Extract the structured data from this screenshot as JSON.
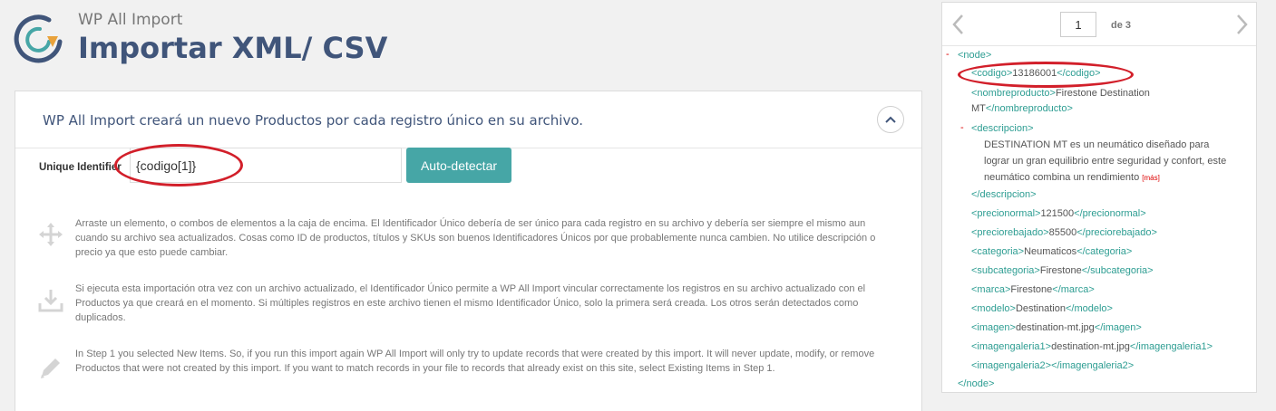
{
  "header": {
    "brand": "WP All Import",
    "title": "Importar XML/ CSV"
  },
  "panel": {
    "title": "WP All Import creará un nuevo Productos por cada registro único en su archivo.",
    "unique_label": "Unique Identifier",
    "unique_value": "{codigo[1]}",
    "auto_detect_label": "Auto-detectar",
    "info": [
      {
        "icon": "move-icon",
        "text": "Arraste un elemento, o combos de elementos a la caja de encima. El Identificador Único debería de ser único para cada registro en su archivo y debería ser siempre el mismo aun cuando su archivo sea actualizados. Cosas como ID de productos, títulos y SKUs son buenos Identificadores Únicos por que probablemente nunca cambien. No utilice descripción o precio ya que esto puede cambiar."
      },
      {
        "icon": "download-icon",
        "text": "Si ejecuta esta importación otra vez con un archivo actualizado, el Identificador Único permite a WP All Import vincular correctamente los registros en su archivo actualizado con el Productos ya que creará en el momento. Si múltiples registros en este archivo tienen el mismo Identificador Único, solo la primera será creada. Los otros serán detectados como duplicados."
      },
      {
        "icon": "pencil-icon",
        "text": "In Step 1 you selected New Items. So, if you run this import again WP All Import will only try to update records that were created by this import. It will never update, modify, or remove Productos that were not created by this import. If you want to match records in your file to records that already exist on this site, select Existing Items in Step 1."
      }
    ]
  },
  "xml": {
    "page": "1",
    "of_label": "de 3",
    "toggle": "-",
    "more_label": "[más]",
    "lines": {
      "node_open": "<node>",
      "codigo_open": "<codigo>",
      "codigo_val": "13186001",
      "codigo_close": "</codigo>",
      "nombre_open": "<nombreproducto>",
      "nombre_val1": "Firestone Destination",
      "nombre_val2": "MT",
      "nombre_close": "</nombreproducto>",
      "desc_open": "<descripcion>",
      "desc_val1": "DESTINATION MT es un neumático diseñado para",
      "desc_val2": "lograr un gran equilibrio entre seguridad y confort, este",
      "desc_val3": "neumático combina un rendimiento",
      "desc_close": "</descripcion>",
      "pn_open": "<precionormal>",
      "pn_val": "121500",
      "pn_close": "</precionormal>",
      "pr_open": "<preciorebajado>",
      "pr_val": "85500",
      "pr_close": "</preciorebajado>",
      "cat_open": "<categoria>",
      "cat_val": "Neumaticos",
      "cat_close": "</categoria>",
      "sub_open": "<subcategoria>",
      "sub_val": "Firestone",
      "sub_close": "</subcategoria>",
      "marca_open": "<marca>",
      "marca_val": "Firestone",
      "marca_close": "</marca>",
      "modelo_open": "<modelo>",
      "modelo_val": "Destination",
      "modelo_close": "</modelo>",
      "img_open": "<imagen>",
      "img_val": "destination-mt.jpg",
      "img_close": "</imagen>",
      "ig1_open": "<imagengaleria1>",
      "ig1_val": "destination-mt.jpg",
      "ig1_close": "</imagengaleria1>",
      "ig2_open": "<imagengaleria2>",
      "ig2_close": "</imagengaleria2>",
      "node_close": "</node>"
    }
  },
  "colors": {
    "title": "#40557a",
    "accent": "#46a6a6",
    "xml_tag": "#2d9d92",
    "annotation": "#d21f2a"
  }
}
